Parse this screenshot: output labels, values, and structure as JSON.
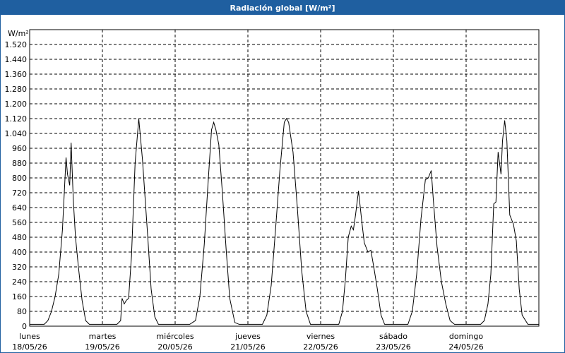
{
  "window": {
    "title": "Radiación global [W/m²]"
  },
  "chart_data": {
    "type": "line",
    "title": "Radiación global [W/m²]",
    "ylabel": "W/m²",
    "xlabel": "",
    "ylim": [
      0,
      1600
    ],
    "xlim": [
      0,
      7
    ],
    "yticks": [
      0,
      80,
      160,
      240,
      320,
      400,
      480,
      560,
      640,
      720,
      800,
      880,
      960,
      1040,
      1120,
      1200,
      1280,
      1360,
      1440,
      1520
    ],
    "ytick_labels": [
      "0",
      "80",
      "160",
      "240",
      "320",
      "400",
      "480",
      "560",
      "640",
      "720",
      "800",
      "880",
      "960",
      "1.040",
      "1.120",
      "1.200",
      "1.280",
      "1.360",
      "1.440",
      "1.520"
    ],
    "categories": [
      {
        "day": "lunes",
        "date": "18/05/26"
      },
      {
        "day": "martes",
        "date": "19/05/26"
      },
      {
        "day": "miércoles",
        "date": "20/05/26"
      },
      {
        "day": "jueves",
        "date": "21/05/26"
      },
      {
        "day": "viernes",
        "date": "22/05/26"
      },
      {
        "day": "sábado",
        "date": "23/05/26"
      },
      {
        "day": "domingo",
        "date": "24/05/26"
      }
    ],
    "grid": true,
    "line_color": "#000000",
    "series": [
      {
        "x": [
          0,
          0.2,
          0.25,
          0.3,
          0.35,
          0.4,
          0.45,
          0.5,
          0.52,
          0.55,
          0.57,
          0.6,
          0.63,
          0.67,
          0.72,
          0.77,
          0.82,
          0.85,
          1.2,
          1.25,
          1.27,
          1.3,
          1.33,
          1.36,
          1.4,
          1.45,
          1.5,
          1.55,
          1.62,
          1.67,
          1.72,
          1.77,
          1.82,
          1.86,
          2.2,
          2.28,
          2.34,
          2.4,
          2.45,
          2.5,
          2.53,
          2.56,
          2.6,
          2.65,
          2.7,
          2.75,
          2.82,
          2.88,
          3.2,
          3.26,
          3.32,
          3.38,
          3.44,
          3.5,
          3.53,
          3.56,
          3.62,
          3.68,
          3.74,
          3.8,
          3.86,
          3.9,
          4.25,
          4.3,
          4.34,
          4.38,
          4.42,
          4.45,
          4.48,
          4.52,
          4.57,
          4.6,
          4.65,
          4.69,
          4.73,
          4.78,
          4.83,
          4.88,
          5.2,
          5.26,
          5.32,
          5.38,
          5.44,
          5.48,
          5.52,
          5.55,
          5.6,
          5.66,
          5.72,
          5.78,
          5.84,
          5.88,
          6.2,
          6.25,
          6.3,
          6.34,
          6.38,
          6.41,
          6.44,
          6.48,
          6.5,
          6.53,
          6.56,
          6.6,
          6.65,
          6.69,
          6.73,
          6.77,
          6.85,
          7
        ],
        "values": [
          10,
          10,
          30,
          80,
          160,
          280,
          520,
          910,
          820,
          760,
          990,
          680,
          480,
          320,
          140,
          30,
          10,
          10,
          10,
          30,
          150,
          120,
          140,
          150,
          380,
          880,
          1120,
          900,
          500,
          200,
          50,
          10,
          10,
          10,
          10,
          30,
          160,
          440,
          760,
          1060,
          1100,
          1060,
          980,
          720,
          420,
          150,
          20,
          10,
          10,
          60,
          220,
          520,
          840,
          1100,
          1120,
          1100,
          940,
          640,
          300,
          80,
          10,
          10,
          10,
          80,
          250,
          480,
          540,
          520,
          600,
          730,
          550,
          450,
          400,
          410,
          320,
          200,
          60,
          10,
          10,
          80,
          280,
          580,
          790,
          800,
          840,
          680,
          430,
          240,
          120,
          30,
          10,
          10,
          10,
          30,
          120,
          280,
          660,
          670,
          940,
          820,
          1000,
          1110,
          1000,
          600,
          550,
          460,
          200,
          60,
          10,
          10
        ]
      }
    ]
  }
}
